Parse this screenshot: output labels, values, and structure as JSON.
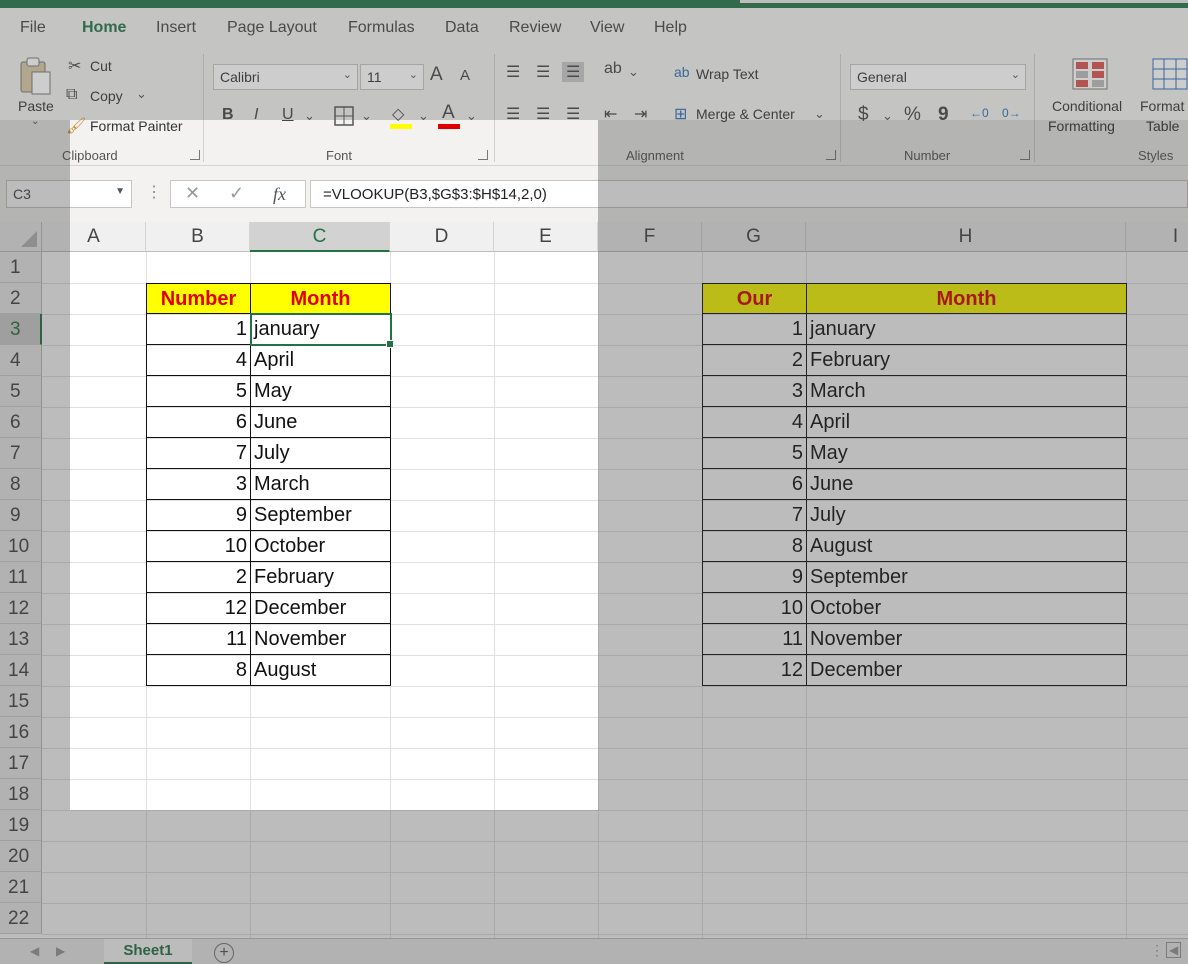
{
  "ribbon_tabs": [
    "File",
    "Home",
    "Insert",
    "Page Layout",
    "Formulas",
    "Data",
    "Review",
    "View",
    "Help"
  ],
  "clipboard": {
    "paste": "Paste",
    "cut": "Cut",
    "copy": "Copy",
    "format_painter": "Format Painter",
    "group": "Clipboard"
  },
  "font": {
    "name": "Calibri",
    "size": "11",
    "group": "Font",
    "bold": "B",
    "italic": "I",
    "underline": "U",
    "grow": "A",
    "shrink": "A"
  },
  "alignment": {
    "wrap": "Wrap Text",
    "merge": "Merge & Center",
    "group": "Alignment"
  },
  "number": {
    "format": "General",
    "group": "Number",
    "currency": "$",
    "percent": "%",
    "comma": "9"
  },
  "styles": {
    "conditional_1": "Conditional",
    "conditional_2": "Formatting",
    "format_table_1": "Format",
    "format_table_2": "Table",
    "group": "Styles"
  },
  "formula_bar": {
    "name_box": "C3",
    "fx": "fx",
    "formula": "=VLOOKUP(B3,$G$3:$H$14,2,0)"
  },
  "columns": [
    "A",
    "B",
    "C",
    "D",
    "E",
    "F",
    "G",
    "H",
    "I"
  ],
  "rows": [
    "1",
    "2",
    "3",
    "4",
    "5",
    "6",
    "7",
    "8",
    "9",
    "10",
    "11",
    "12",
    "13",
    "14",
    "15",
    "16",
    "17",
    "18",
    "19",
    "20",
    "21",
    "22"
  ],
  "left_table": {
    "headers": [
      "Number",
      "Month"
    ],
    "rows": [
      [
        "1",
        "january"
      ],
      [
        "4",
        "April"
      ],
      [
        "5",
        "May"
      ],
      [
        "6",
        "June"
      ],
      [
        "7",
        "July"
      ],
      [
        "3",
        "March"
      ],
      [
        "9",
        "September"
      ],
      [
        "10",
        "October"
      ],
      [
        "2",
        "February"
      ],
      [
        "12",
        "December"
      ],
      [
        "11",
        "November"
      ],
      [
        "8",
        "August"
      ]
    ]
  },
  "right_table": {
    "headers": [
      "Our",
      "Month"
    ],
    "rows": [
      [
        "1",
        "january"
      ],
      [
        "2",
        "February"
      ],
      [
        "3",
        "March"
      ],
      [
        "4",
        "April"
      ],
      [
        "5",
        "May"
      ],
      [
        "6",
        "June"
      ],
      [
        "7",
        "July"
      ],
      [
        "8",
        "August"
      ],
      [
        "9",
        "September"
      ],
      [
        "10",
        "October"
      ],
      [
        "11",
        "November"
      ],
      [
        "12",
        "December"
      ]
    ]
  },
  "sheet": {
    "tab": "Sheet1",
    "add": "+"
  },
  "colors": {
    "accent": "#217346",
    "header_fill": "#ffff00",
    "header_text": "#e00000"
  }
}
